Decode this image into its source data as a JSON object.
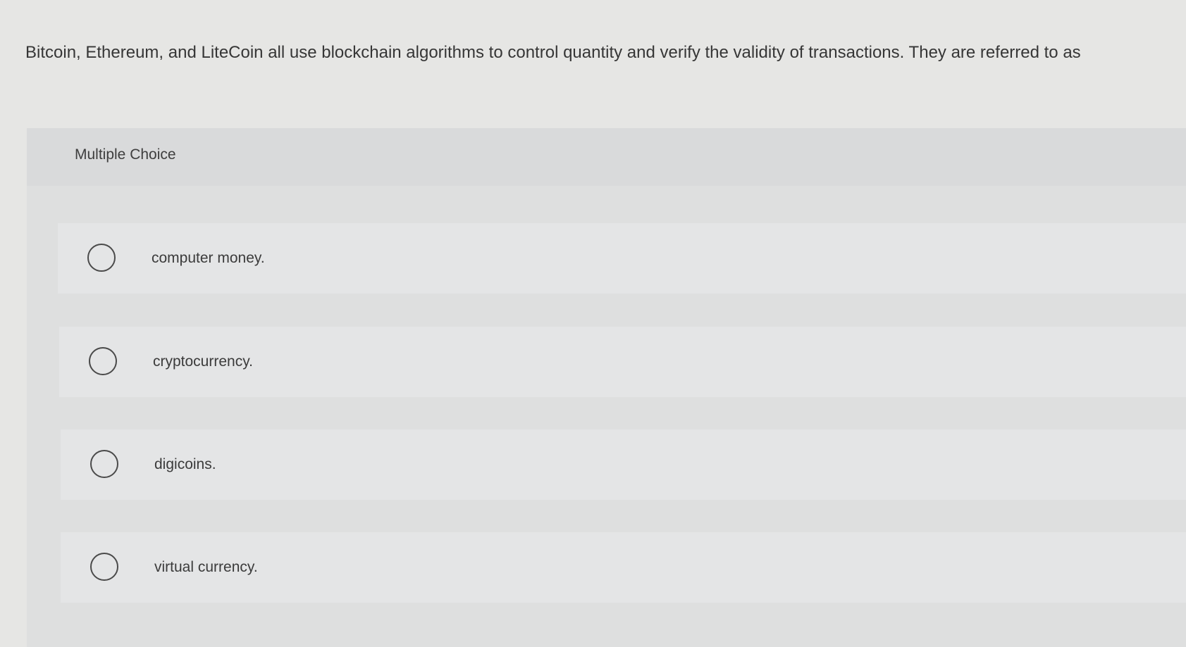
{
  "question": {
    "text": "Bitcoin, Ethereum, and LiteCoin all use blockchain algorithms to control quantity and verify the validity of transactions. They are referred to as"
  },
  "section": {
    "label": "Multiple Choice"
  },
  "options": [
    {
      "label": "computer money.",
      "selected": false
    },
    {
      "label": "cryptocurrency.",
      "selected": false
    },
    {
      "label": "digicoins.",
      "selected": false
    },
    {
      "label": "virtual currency.",
      "selected": false
    }
  ]
}
